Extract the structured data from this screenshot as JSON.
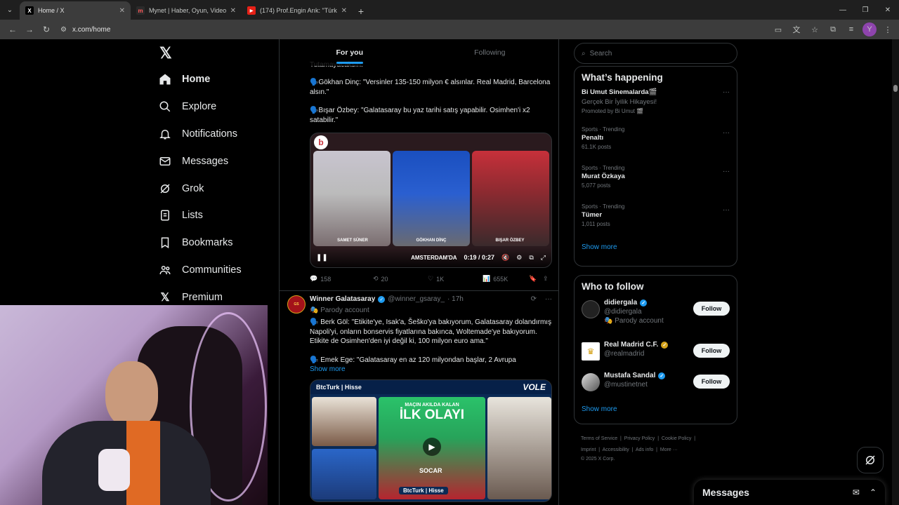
{
  "browser": {
    "tabs": [
      {
        "title": "Home / X",
        "favicon": "X"
      },
      {
        "title": "Mynet | Haber, Oyun, Video, Sp",
        "favicon": "m"
      },
      {
        "title": "(174) Prof.Engin Arık: \"Türkiye",
        "favicon": "▶"
      }
    ],
    "url": "x.com/home",
    "profile_initial": "Y"
  },
  "nav": {
    "items": [
      "Home",
      "Explore",
      "Notifications",
      "Messages",
      "Grok",
      "Lists",
      "Bookmarks",
      "Communities",
      "Premium"
    ]
  },
  "feed": {
    "tabs": [
      "For you",
      "Following"
    ],
    "tweet1": {
      "cut_line": "Tutamayacaksın.",
      "line1": "🗣️Gökhan Dinç: \"Versinler 135-150 milyon € alsınlar. Real Madrid, Barcelona alsın.\"",
      "line2": "🗣️Bışar Özbey: \"Galatasaray bu yaz tarihi satış yapabilir. Osimhen'i x2 satabilir.\"",
      "video": {
        "watermark": "b",
        "names": [
          "SAMET SÜNER",
          "GÖKHAN DİNÇ",
          "BIŞAR ÖZBEY"
        ],
        "ticker": "AMSTERDAM'DA",
        "time": "0:19 / 0:27"
      },
      "stats": {
        "replies": "158",
        "reposts": "20",
        "likes": "1K",
        "views": "655K"
      }
    },
    "tweet2": {
      "name": "Winner Galatasaray",
      "handle": "@winner_gsaray_",
      "time": "· 17h",
      "label": "Parody account",
      "line1": "🗣️ Berk Göl: \"Etikite'ye, Isak'a, Šeško'ya bakıyorum, Galatasaray dolandırmış Napoli'yi, onların bonservis fiyatlarına bakınca, Woltemade'ye bakıyorum. Etikite de Osimhen'den iyi değil ki, 100 milyon euro ama.\"",
      "line2": "🗣️ Emek Ege: \"Galatasaray en az 120 milyondan başlar, 2 Avrupa",
      "show_more": "Show more",
      "video": {
        "brand": "BtcTurk | Hisse",
        "corner": "VOLE",
        "banner1": "MAÇIN AKILDA KALAN",
        "banner2": "İLK OLAYI",
        "sponsor": "SOCAR",
        "footer": "BtcTurk | Hisse"
      }
    }
  },
  "sidebar": {
    "search_placeholder": "Search",
    "happening": {
      "title": "What’s happening",
      "promo": {
        "name": "Bi Umut Sinemalarda🎬",
        "desc": "Gerçek Bir İyilik Hikayesi!",
        "promoted": "Promoted by Bi Umut 🎬"
      },
      "trends": [
        {
          "meta": "Sports · Trending",
          "name": "Penaltı",
          "posts": "61.1K posts"
        },
        {
          "meta": "Sports · Trending",
          "name": "Murat Özkaya",
          "posts": "5,077 posts"
        },
        {
          "meta": "Sports · Trending",
          "name": "Tümer",
          "posts": "1,011 posts"
        }
      ],
      "show_more": "Show more"
    },
    "who_to_follow": {
      "title": "Who to follow",
      "users": [
        {
          "name": "didiergala",
          "handle": "@didiergala",
          "label": "Parody account",
          "button": "Follow"
        },
        {
          "name": "Real Madrid C.F.",
          "handle": "@realmadrid",
          "button": "Follow"
        },
        {
          "name": "Mustafa Sandal",
          "handle": "@mustinetnet",
          "button": "Follow"
        }
      ],
      "show_more": "Show more"
    },
    "footer": {
      "links": [
        "Terms of Service",
        "Privacy Policy",
        "Cookie Policy",
        "Imprint",
        "Accessibility",
        "Ads info",
        "More ···"
      ],
      "copyright": "© 2025 X Corp."
    }
  },
  "messages_dock": {
    "title": "Messages"
  },
  "colors": {
    "accent": "#1d9bf0",
    "bg": "#000000",
    "border": "#2f3336",
    "muted": "#71767b"
  }
}
